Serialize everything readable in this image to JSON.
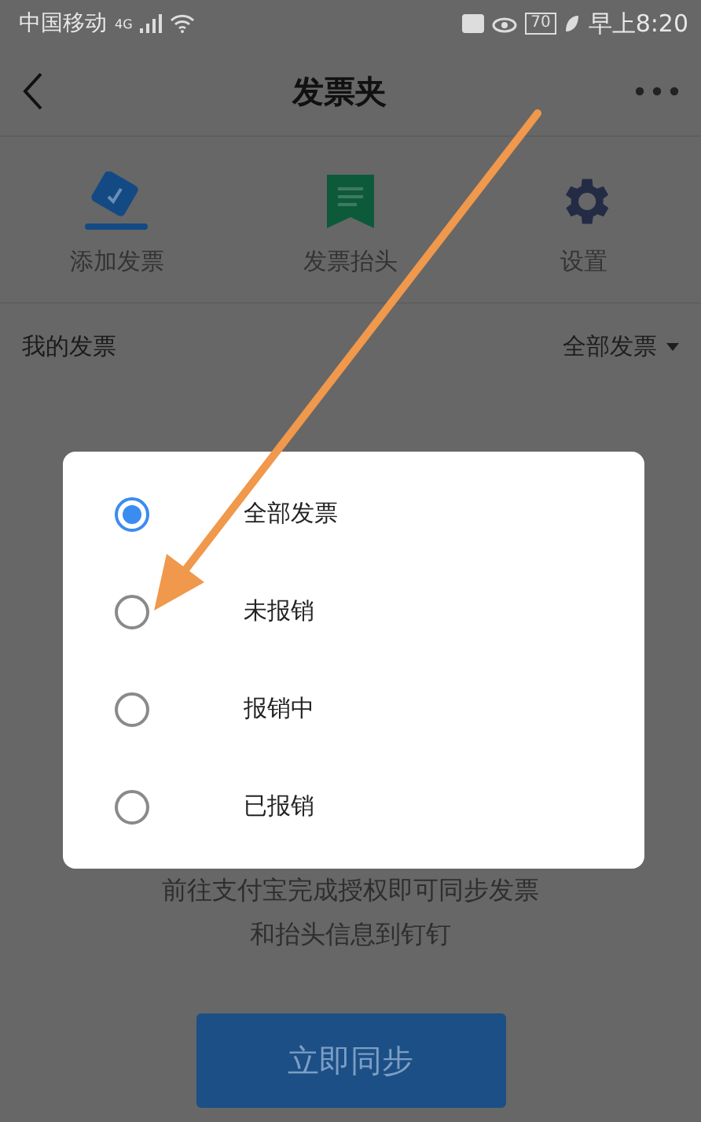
{
  "status_bar": {
    "carrier": "中国移动",
    "network": "4G",
    "battery": "70",
    "time": "早上8:20"
  },
  "nav": {
    "title": "发票夹"
  },
  "actions": [
    {
      "label": "添加发票",
      "kind": "add"
    },
    {
      "label": "发票抬头",
      "kind": "title"
    },
    {
      "label": "设置",
      "kind": "settings"
    }
  ],
  "section": {
    "title": "我的发票",
    "filter": "全部发票"
  },
  "dialog": {
    "options": [
      {
        "label": "全部发票",
        "selected": true
      },
      {
        "label": "未报销",
        "selected": false
      },
      {
        "label": "报销中",
        "selected": false
      },
      {
        "label": "已报销",
        "selected": false
      }
    ]
  },
  "sync": {
    "message_lines": [
      "前往支付宝完成授权即可同步发票",
      "和抬头信息到钉钉"
    ],
    "button": "立即同步"
  }
}
